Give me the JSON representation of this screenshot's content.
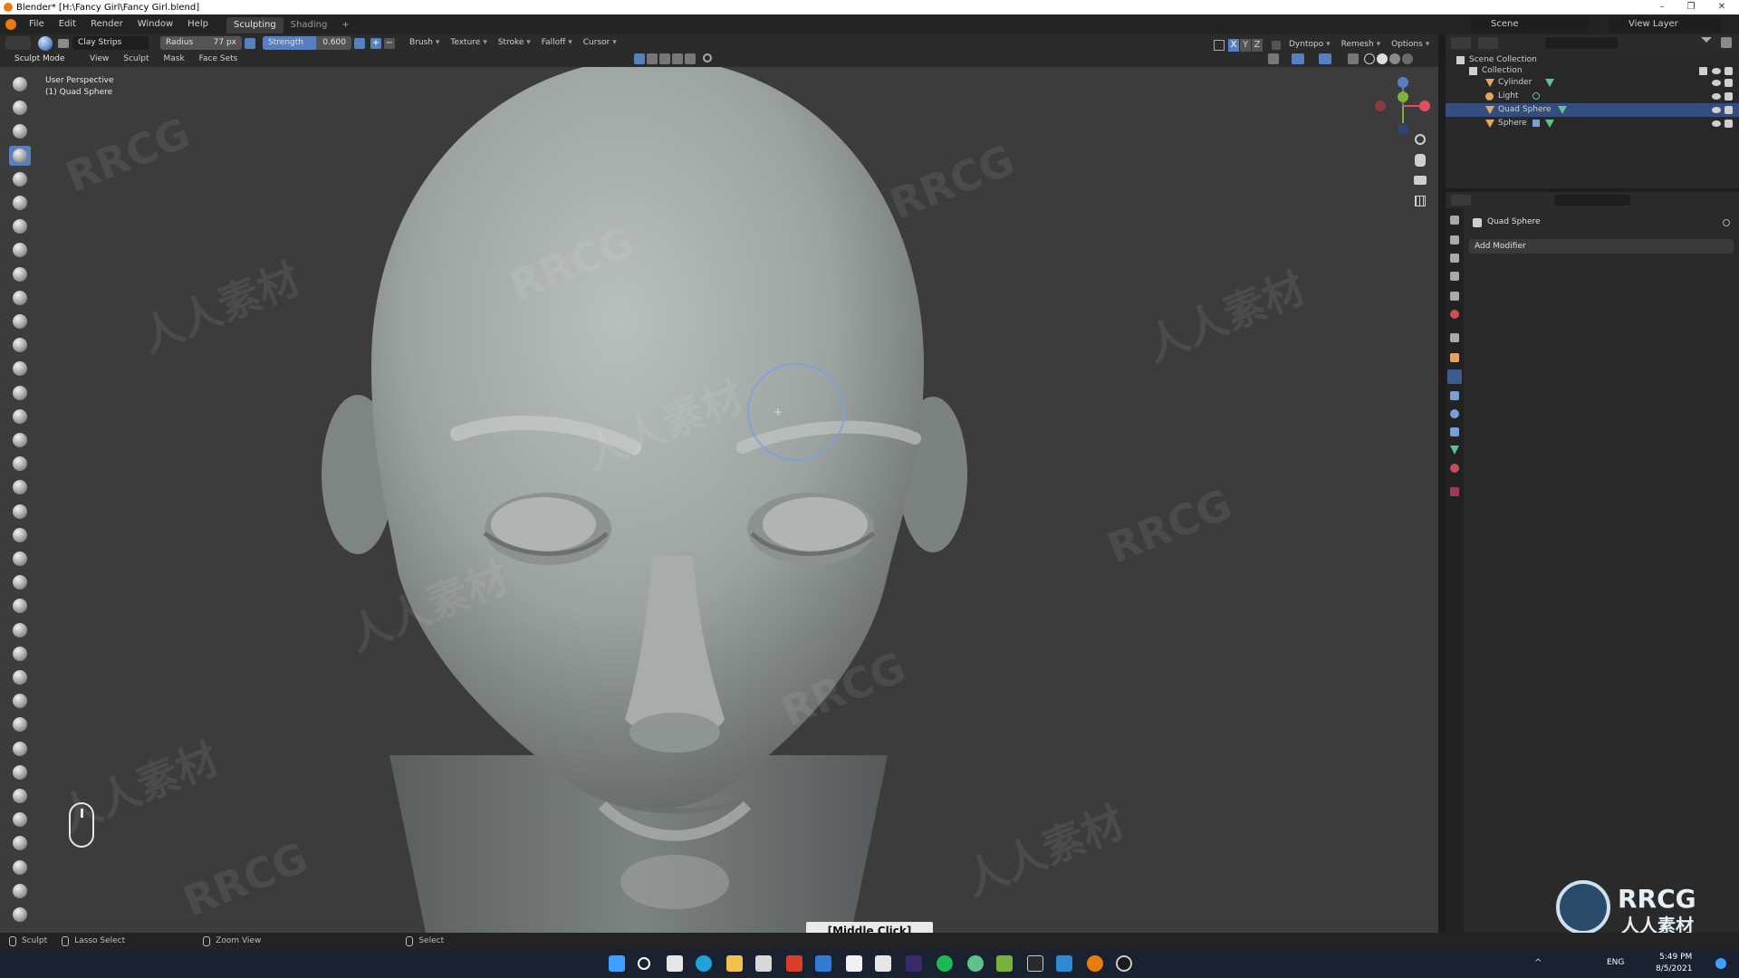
{
  "window": {
    "title": "Blender* [H:\\Fancy Girl\\Fancy Girl.blend]",
    "minimize": "–",
    "maximize": "❐",
    "close": "✕"
  },
  "menu": {
    "items": [
      "File",
      "Edit",
      "Render",
      "Window",
      "Help"
    ],
    "tabs": [
      "Sculpting",
      "Shading"
    ],
    "add_tab": "+"
  },
  "top_right": {
    "scene": "Scene",
    "view_layer": "View Layer"
  },
  "tool_header": {
    "brush_name": "Clay Strips",
    "radius_label": "Radius",
    "radius_value": "77 px",
    "strength_label": "Strength",
    "strength_value": "0.600",
    "brush": "Brush",
    "texture": "Texture",
    "stroke": "Stroke",
    "falloff": "Falloff",
    "cursor": "Cursor",
    "axes": [
      "X",
      "Y",
      "Z"
    ],
    "dyntopo": "Dyntopo",
    "remesh": "Remesh",
    "options": "Options"
  },
  "mode_header": {
    "mode": "Sculpt Mode",
    "items": [
      "View",
      "Sculpt",
      "Mask",
      "Face Sets"
    ]
  },
  "viewport": {
    "perspective": "User Perspective",
    "object": "(1) Quad Sphere",
    "middle_click": "[Middle Click]"
  },
  "watermarks": [
    "RRCG",
    "人人素材"
  ],
  "outliner": {
    "scene_collection": "Scene Collection",
    "collection": "Collection",
    "objects": [
      {
        "name": "Cylinder",
        "selected": false
      },
      {
        "name": "Light",
        "selected": false
      },
      {
        "name": "Quad Sphere",
        "selected": true
      },
      {
        "name": "Sphere",
        "selected": false
      }
    ]
  },
  "properties": {
    "object_name": "Quad Sphere",
    "add_modifier": "Add Modifier"
  },
  "statusbar": {
    "items": [
      "Sculpt",
      "Lasso Select",
      "Zoom View",
      "Select"
    ]
  },
  "taskbar": {
    "lang": "ENG",
    "time": "5:49 PM",
    "date": "8/5/2021"
  },
  "logo": {
    "brand": "RRCG",
    "sub": "人人素材"
  },
  "colors": {
    "accent": "#5680c2",
    "selection": "#334d80",
    "viewport_bg": "#3c3c3c"
  }
}
